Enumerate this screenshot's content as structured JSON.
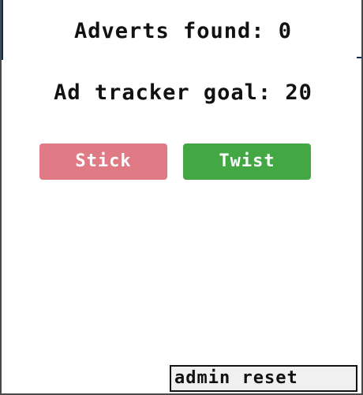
{
  "counter": {
    "found_label": "Adverts found:",
    "found_value": "0",
    "goal_label": "Ad tracker goal:",
    "goal_value": "20"
  },
  "actions": {
    "stick_label": "Stick",
    "twist_label": "Twist"
  },
  "admin": {
    "reset_label": "admin reset"
  },
  "colors": {
    "stick": "#e07b86",
    "twist": "#43a843",
    "text": "#111111",
    "background": "#ffffff"
  }
}
